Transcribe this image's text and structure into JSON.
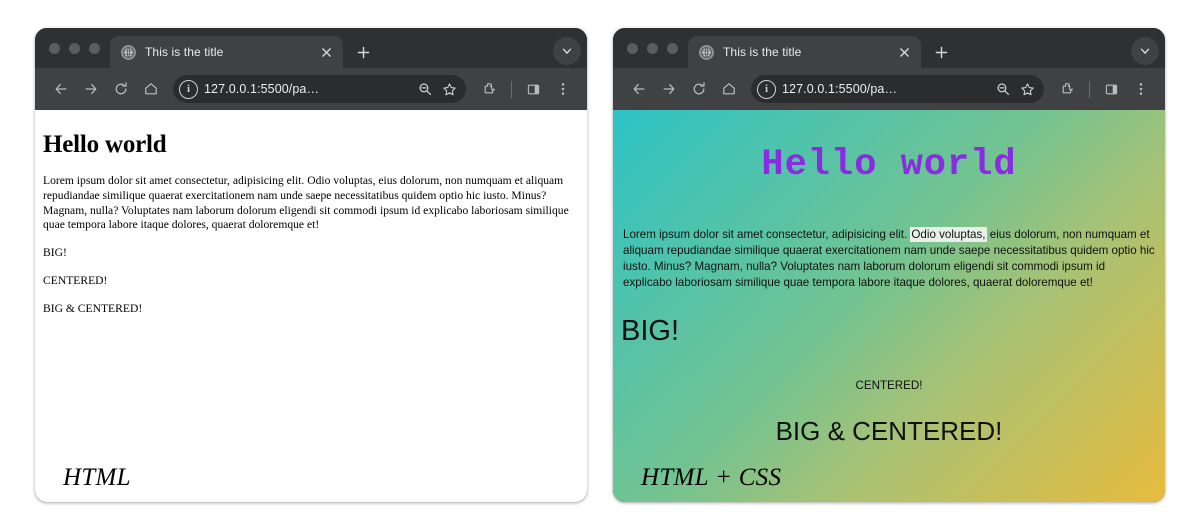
{
  "windows": [
    {
      "key": "plain",
      "browser": {
        "tab": {
          "title": "This is the title",
          "favicon": "globe-icon",
          "close": "×"
        },
        "new_tab": "+",
        "tabstrip_menu": "chevron-down-icon",
        "toolbar": {
          "back": "←",
          "forward": "→",
          "reload": "reload-icon",
          "home": "home-icon",
          "site_info": "i",
          "url": "127.0.0.1:5500/pa…",
          "zoom": "zoom-out-icon",
          "bookmark": "star-icon",
          "extensions": "puzzle-icon",
          "side_panel": "side-panel-icon",
          "menu": "kebab-menu-icon"
        }
      },
      "page": {
        "heading": "Hello world",
        "paragraph": "Lorem ipsum dolor sit amet consectetur, adipisicing elit. Odio voluptas, eius dolorum, non numquam et aliquam repudiandae similique quaerat exercitationem nam unde saepe necessitatibus quidem optio hic iusto. Minus? Magnam, nulla? Voluptates nam laborum dolorum eligendi sit commodi ipsum id explicabo laboriosam similique quae tempora labore itaque dolores, quaerat doloremque et!",
        "big": "BIG!",
        "centered": "CENTERED!",
        "big_centered": "BIG & CENTERED!"
      },
      "caption": "HTML"
    },
    {
      "key": "styled",
      "browser": {
        "tab": {
          "title": "This is the title",
          "favicon": "globe-icon",
          "close": "×"
        },
        "new_tab": "+",
        "tabstrip_menu": "chevron-down-icon",
        "toolbar": {
          "back": "←",
          "forward": "→",
          "reload": "reload-icon",
          "home": "home-icon",
          "site_info": "i",
          "url": "127.0.0.1:5500/pa…",
          "zoom": "zoom-out-icon",
          "bookmark": "star-icon",
          "extensions": "puzzle-icon",
          "side_panel": "side-panel-icon",
          "menu": "kebab-menu-icon"
        }
      },
      "page": {
        "heading": "Hello world",
        "paragraph_before": "Lorem ipsum dolor sit amet consectetur, adipisicing elit. ",
        "paragraph_highlight": "Odio voluptas,",
        "paragraph_after": " eius dolorum, non numquam et aliquam repudiandae similique quaerat exercitationem nam unde saepe necessitatibus quidem optio hic iusto. Minus? Magnam, nulla? Voluptates nam laborum dolorum eligendi sit commodi ipsum id explicabo laboriosam similique quae tempora labore itaque dolores, quaerat doloremque et!",
        "big": "BIG!",
        "centered": "CENTERED!",
        "big_centered": "BIG & CENTERED!"
      },
      "caption": "HTML + CSS"
    }
  ],
  "colors": {
    "chrome": "#2f3032",
    "toolbar": "#404143",
    "omnibox": "#2b2c2e",
    "heading_purple": "#8a2be2",
    "gradient_start": "#2dc3c5",
    "gradient_mid": "#74c390",
    "gradient_end": "#e8bb3e",
    "highlight": "#e9f0e9"
  }
}
